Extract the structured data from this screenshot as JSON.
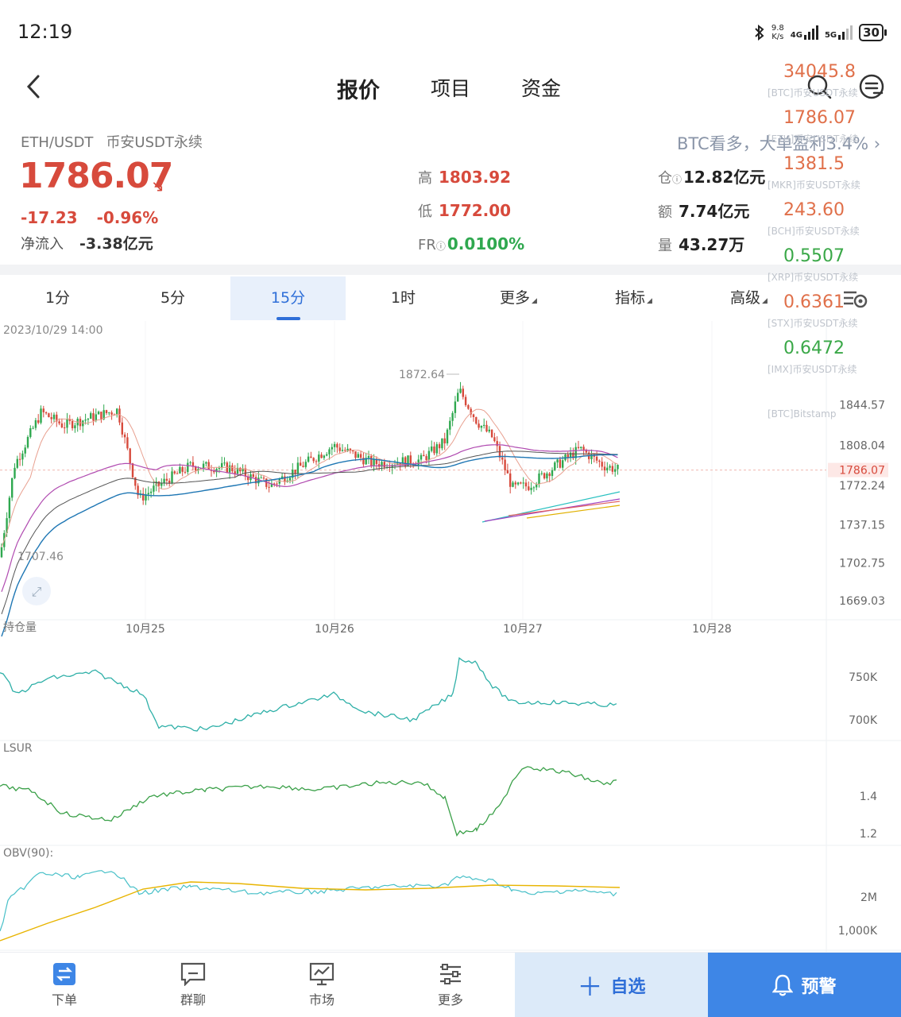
{
  "status_bar": {
    "time": "12:19",
    "speed_value": "9.8",
    "speed_unit": "K/s",
    "net1": "4G",
    "net2": "5G",
    "battery": "30"
  },
  "header": {
    "tabs": [
      "报价",
      "项目",
      "资金"
    ]
  },
  "quote": {
    "pair": "ETH/USDT",
    "market": "币安USDT永续",
    "price": "1786.07",
    "change": "-17.23",
    "change_pct": "-0.96%",
    "netflow_label": "净流入",
    "netflow_value": "-3.38亿元",
    "high_label": "高",
    "high": "1803.92",
    "low_label": "低",
    "low": "1772.00",
    "fr_label": "FR",
    "fr": "0.0100%",
    "oi_label": "仓",
    "oi": "12.82亿元",
    "amount_label": "额",
    "amount": "7.74亿元",
    "volume_label": "量",
    "volume": "43.27万"
  },
  "banner": "BTC看多，大单盈利3.4%",
  "ticker": [
    {
      "value": "34045.8",
      "name": "[BTC]币安USDT永续",
      "color": "red"
    },
    {
      "value": "1786.07",
      "name": "[ETH]币安USDT永续",
      "color": "red"
    },
    {
      "value": "1381.5",
      "name": "[MKR]币安USDT永续",
      "color": "red"
    },
    {
      "value": "243.60",
      "name": "[BCH]币安USDT永续",
      "color": "red"
    },
    {
      "value": "0.5507",
      "name": "[XRP]币安USDT永续",
      "color": "green"
    },
    {
      "value": "0.6361",
      "name": "[STX]币安USDT永续",
      "color": "red"
    },
    {
      "value": "0.6472",
      "name": "[IMX]币安USDT永续",
      "color": "green"
    },
    {
      "value": "",
      "name": "[BTC]Bitstamp",
      "color": "red"
    }
  ],
  "periods": [
    "1分",
    "5分",
    "15分",
    "1时",
    "更多",
    "指标",
    "高级"
  ],
  "chart_data": {
    "type": "candlestick",
    "timestamp": "2023/10/29 14:00",
    "x_labels": [
      "10月25",
      "10月26",
      "10月27",
      "10月28"
    ],
    "y_ticks": [
      "1844.57",
      "1808.04",
      "1786.07",
      "1772.24",
      "1737.15",
      "1702.75",
      "1669.03"
    ],
    "current_price": "1786.07",
    "max_label": "1872.64",
    "min_label": "1707.46",
    "indicators": [
      {
        "name": "持仓量",
        "ticks": [
          "750K",
          "700K"
        ]
      },
      {
        "name": "LSUR",
        "ticks": [
          "1.4",
          "1.2"
        ]
      },
      {
        "name": "OBV(90):",
        "ticks": [
          "2M",
          "1,000K"
        ]
      }
    ]
  },
  "bottom_bar": {
    "order": "下单",
    "chat": "群聊",
    "market": "市场",
    "more": "更多",
    "watch": "自选",
    "alert": "预警"
  },
  "colors": {
    "up": "#2fa84f",
    "down": "#d74a3c",
    "accent": "#2f6fd8"
  }
}
